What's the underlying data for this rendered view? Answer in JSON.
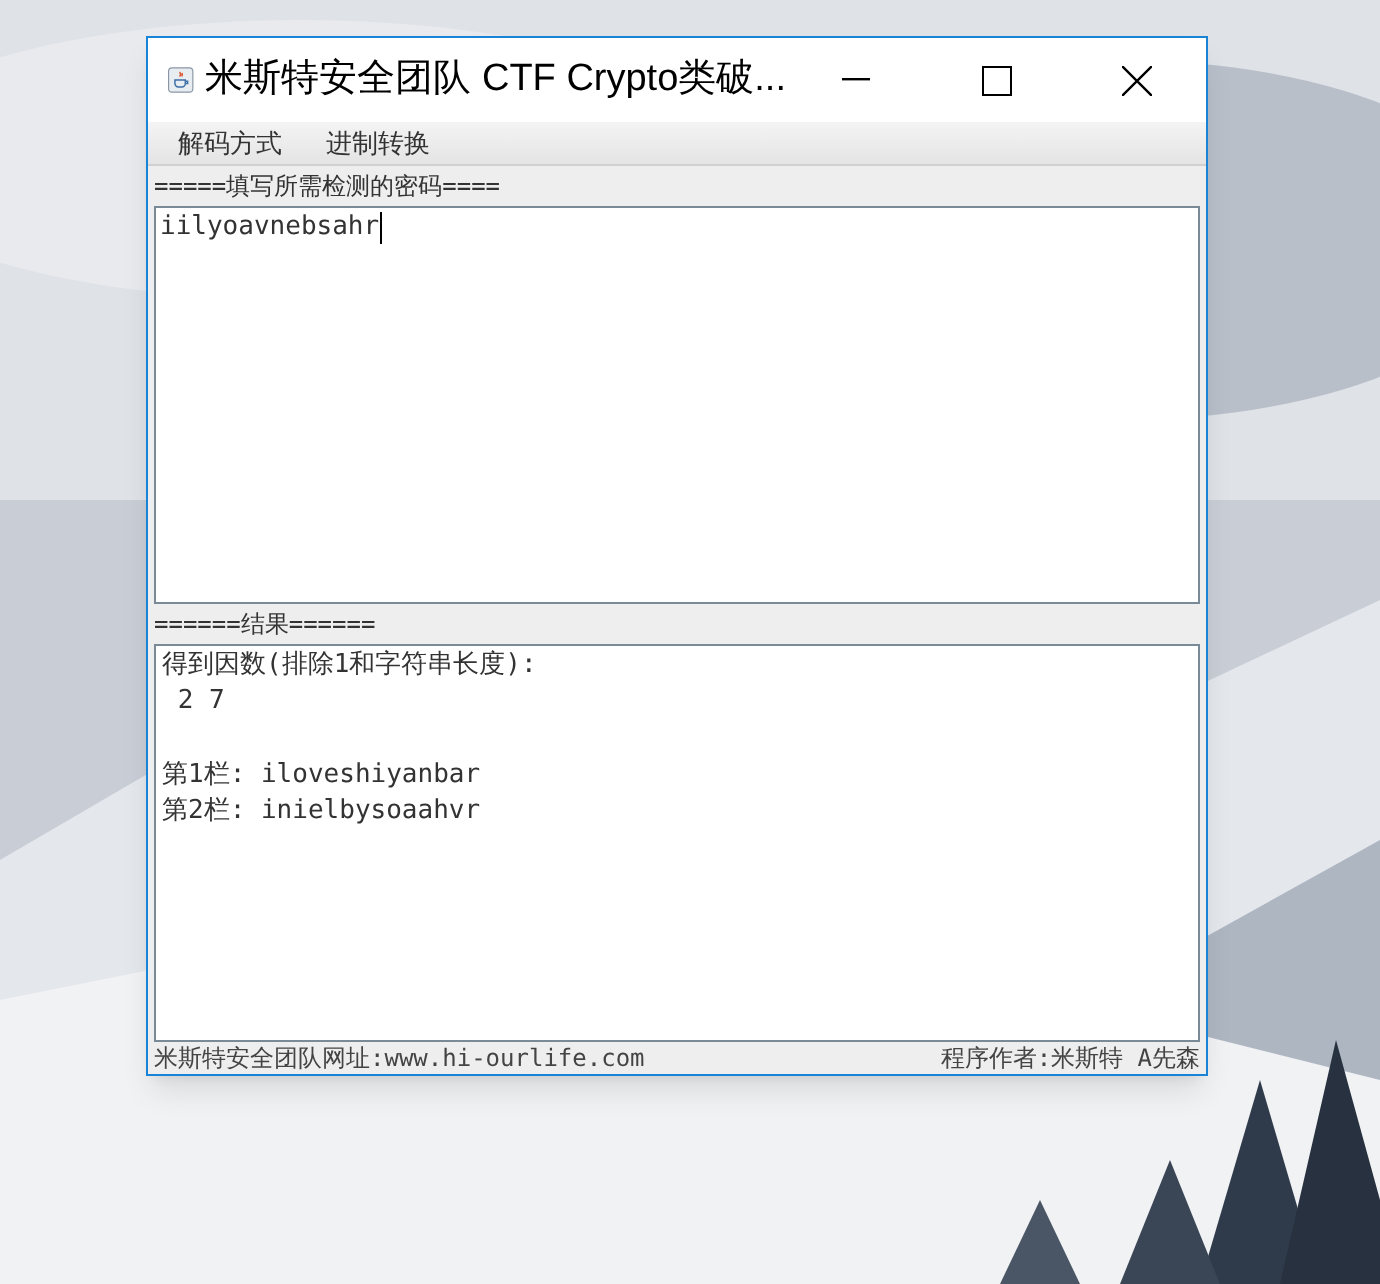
{
  "window": {
    "title": "米斯特安全团队 CTF Crypto类破..."
  },
  "menu": [
    {
      "label": "解码方式"
    },
    {
      "label": "进制转换"
    }
  ],
  "input_section": {
    "label": "=====填写所需检测的密码====",
    "value": "iilyoavnebsahr"
  },
  "result_section": {
    "label": "======结果======",
    "factors_label": "得到因数(排除1和字符串长度):",
    "factors": " 2 7",
    "columns": [
      "第1栏: iloveshiyanbar",
      "第2栏: inielbysoaahvr"
    ]
  },
  "status_bar": {
    "left": "米斯特安全团队网址:www.hi-ourlife.com",
    "right": "程序作者:米斯特 A先森"
  }
}
